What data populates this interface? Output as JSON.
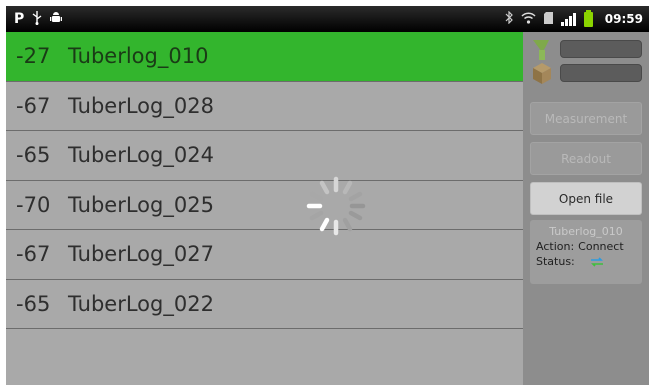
{
  "status_bar": {
    "left_icons": [
      "p-notification-icon",
      "usb-icon",
      "android-debug-icon"
    ],
    "right_icons": [
      "bluetooth-icon",
      "wifi-icon",
      "sd-card-icon",
      "signal-icon",
      "battery-icon"
    ],
    "time": "09:59",
    "battery_color": "#8bd400"
  },
  "devices": [
    {
      "rssi": "-27",
      "name": "Tuberlog_010",
      "selected": true
    },
    {
      "rssi": "-67",
      "name": "TuberLog_028",
      "selected": false
    },
    {
      "rssi": "-65",
      "name": "TuberLog_024",
      "selected": false
    },
    {
      "rssi": "-70",
      "name": "TuberLog_025",
      "selected": false
    },
    {
      "rssi": "-67",
      "name": "TuberLog_027",
      "selected": false
    },
    {
      "rssi": "-65",
      "name": "TuberLog_022",
      "selected": false
    }
  ],
  "colors": {
    "selected_row": "#33b52d",
    "list_bg": "#a9a9a9",
    "panel_bg": "#8d8d8d"
  },
  "panel": {
    "measurement_label": "Measurement",
    "readout_label": "Readout",
    "open_file_label": "Open file",
    "device_name": "Tuberlog_010",
    "action_label": "Action:",
    "action_value": "Connect",
    "status_label": "Status:",
    "status_icon": "sync-arrows-icon"
  },
  "loading": true
}
